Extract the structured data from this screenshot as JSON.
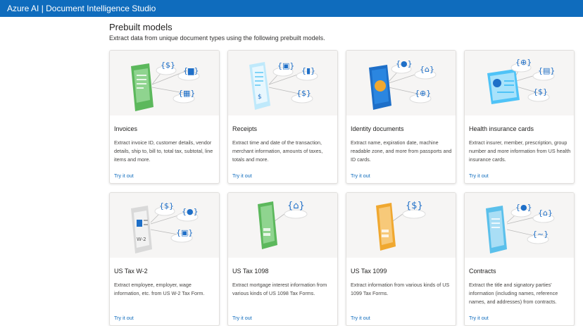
{
  "app": {
    "title": "Azure AI | Document Intelligence Studio"
  },
  "section": {
    "title": "Prebuilt models",
    "subtitle": "Extract data from unique document types using the following prebuilt models."
  },
  "cards": [
    {
      "title": "Invoices",
      "description": "Extract invoice ID, customer details, vendor details, ship to, bill to, total tax, subtotal, line items and more.",
      "link": "Try it out",
      "doc_color": "#5cb85c",
      "icons": [
        "dollar-icon",
        "truck-icon",
        "calculator-icon"
      ]
    },
    {
      "title": "Receipts",
      "description": "Extract time and date of the transaction, merchant information, amounts of taxes, totals and more.",
      "link": "Try it out",
      "doc_color": "#7fd3f7",
      "icons": [
        "store-icon",
        "bag-icon",
        "dollar-icon"
      ]
    },
    {
      "title": "Identity documents",
      "description": "Extract name, expiration date, machine readable zone, and more from passports and ID cards.",
      "link": "Try it out",
      "doc_color": "#1e6fc8",
      "icons": [
        "person-icon",
        "home-icon",
        "globe-icon"
      ]
    },
    {
      "title": "Health insurance cards",
      "description": "Extract insurer, member, prescription, group number and more information from US health insurance cards.",
      "link": "Try it out",
      "doc_color": "#4fc3f7",
      "icons": [
        "globe-icon",
        "id-icon",
        "dollar-icon"
      ]
    },
    {
      "title": "US Tax W-2",
      "description": "Extract employee, employer, wage information, etc. from US W-2 Tax Form.",
      "link": "Try it out",
      "doc_color": "#d9d9d9",
      "icons": [
        "dollar-icon",
        "person-icon",
        "store-icon"
      ]
    },
    {
      "title": "US Tax 1098",
      "description": "Extract mortgage interest information from various kinds of US 1098 Tax Forms.",
      "link": "Try it out",
      "doc_color": "#5cb85c",
      "icons": [
        "home-icon"
      ]
    },
    {
      "title": "US Tax 1099",
      "description": "Extract information from various kinds of US 1099 Tax Forms.",
      "link": "Try it out",
      "doc_color": "#f0a830",
      "icons": [
        "dollar-icon"
      ]
    },
    {
      "title": "Contracts",
      "description": "Extract the title and signatory parties' information (including names, reference names, and addresses) from contracts.",
      "link": "Try it out",
      "doc_color": "#5bc0eb",
      "icons": [
        "person-icon",
        "home-icon",
        "signature-icon"
      ]
    }
  ]
}
